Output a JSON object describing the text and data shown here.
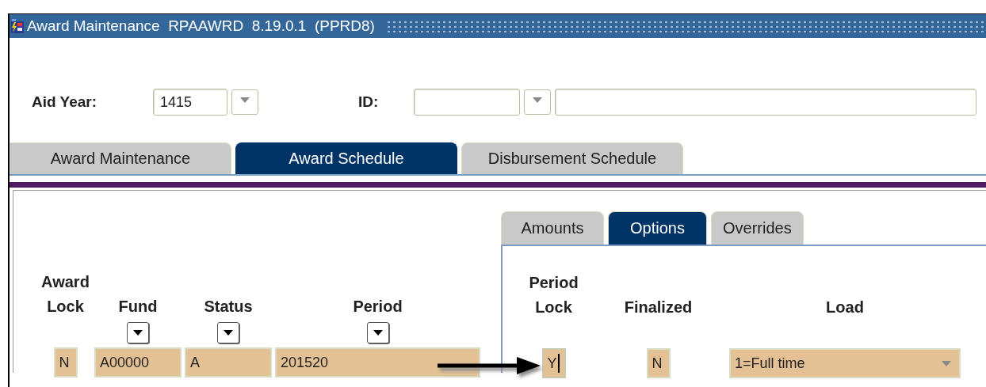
{
  "window": {
    "title": "Award Maintenance  RPAAWRD  8.19.0.1  (PPRD8)"
  },
  "key_block": {
    "aid_year": {
      "label": "Aid Year:",
      "value": "1415"
    },
    "id": {
      "label": "ID:"
    }
  },
  "tabs": [
    {
      "label": "Award Maintenance",
      "selected": false
    },
    {
      "label": "Award Schedule",
      "selected": true
    },
    {
      "label": "Disbursement Schedule",
      "selected": false
    }
  ],
  "schedule": {
    "columns": [
      {
        "label": "Award Lock",
        "kind": "flag"
      },
      {
        "label": "Fund",
        "kind": "lookup"
      },
      {
        "label": "Status",
        "kind": "lookup"
      },
      {
        "label": "Period",
        "kind": "lookup"
      }
    ],
    "row": [
      "N",
      "A00000",
      "A",
      "201520"
    ]
  },
  "sub_tabs": [
    {
      "label": "Amounts",
      "selected": false
    },
    {
      "label": "Options",
      "selected": true
    },
    {
      "label": "Overrides",
      "selected": false
    }
  ],
  "options": {
    "columns": [
      {
        "label": "Period Lock",
        "kind": "flag"
      },
      {
        "label": "Finalized",
        "kind": "flag"
      },
      {
        "label": "Load",
        "kind": "select"
      }
    ],
    "row": [
      {
        "value": "Y",
        "focused": true
      },
      {
        "value": "N",
        "focused": false
      },
      {
        "value": "1=Full time",
        "focused": false
      }
    ]
  }
}
